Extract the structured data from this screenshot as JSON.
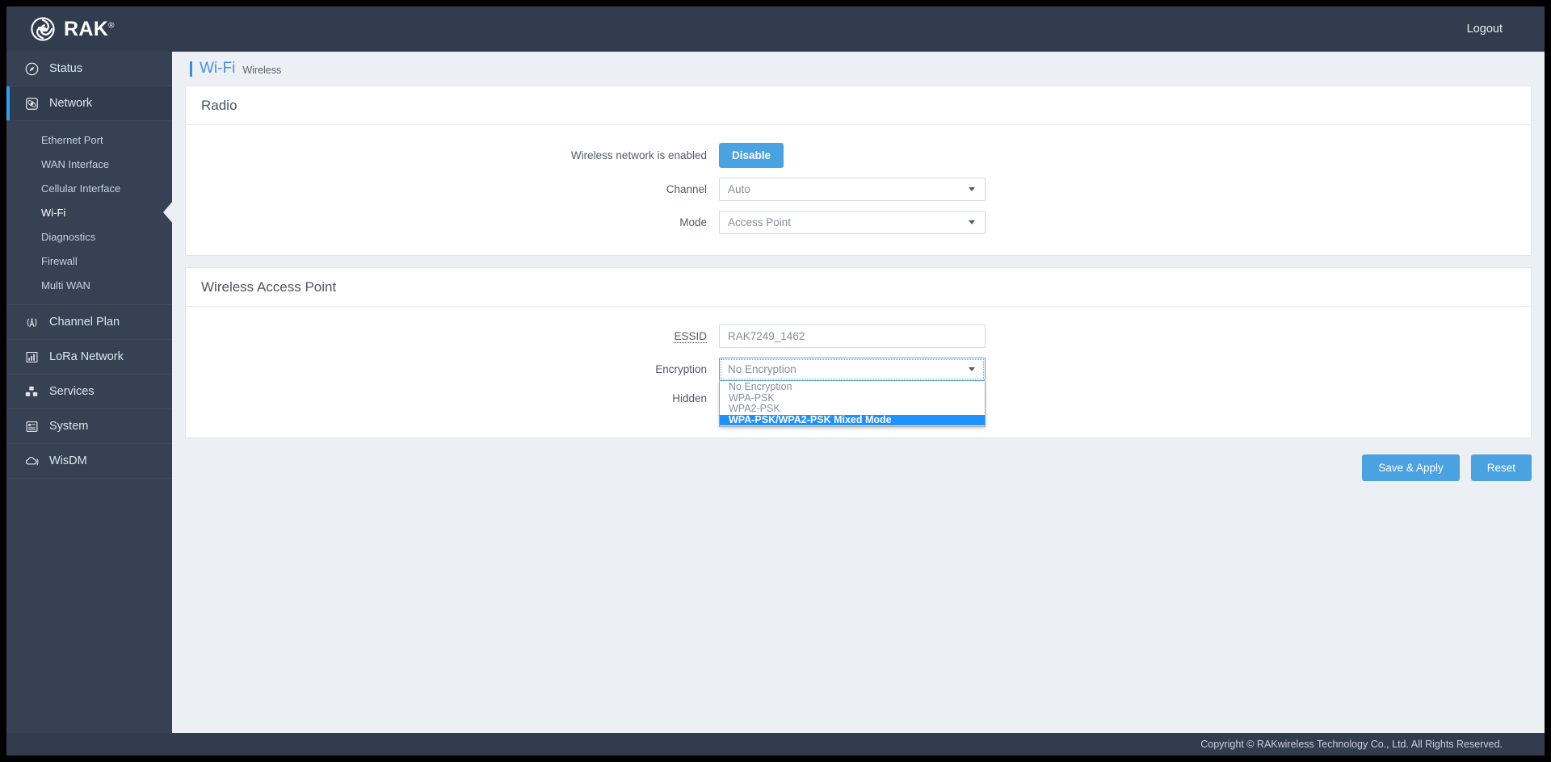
{
  "header": {
    "brand": "RAK",
    "brand_mark": "®",
    "logo_icon": "rak-swirl-logo-icon",
    "logout_label": "Logout"
  },
  "sidebar": {
    "items": [
      {
        "label": "Status",
        "icon": "compass-icon",
        "active": false
      },
      {
        "label": "Network",
        "icon": "network-atom-icon",
        "active": true
      },
      {
        "label": "Channel Plan",
        "icon": "antenna-icon",
        "active": false
      },
      {
        "label": "LoRa Network",
        "icon": "bar-chart-icon",
        "active": false
      },
      {
        "label": "Services",
        "icon": "cubes-icon",
        "active": false
      },
      {
        "label": "System",
        "icon": "list-window-icon",
        "active": false
      },
      {
        "label": "WisDM",
        "icon": "cloud-signal-icon",
        "active": false
      }
    ],
    "network_subitems": [
      {
        "label": "Ethernet Port",
        "current": false
      },
      {
        "label": "WAN Interface",
        "current": false
      },
      {
        "label": "Cellular Interface",
        "current": false
      },
      {
        "label": "Wi-Fi",
        "current": true
      },
      {
        "label": "Diagnostics",
        "current": false
      },
      {
        "label": "Firewall",
        "current": false
      },
      {
        "label": "Multi WAN",
        "current": false
      }
    ]
  },
  "page": {
    "title": "Wi-Fi",
    "subtitle": "Wireless"
  },
  "radio": {
    "heading": "Radio",
    "enabled_label": "Wireless network is enabled",
    "toggle_button": "Disable",
    "channel_label": "Channel",
    "channel_value": "Auto",
    "mode_label": "Mode",
    "mode_value": "Access Point"
  },
  "access_point": {
    "heading": "Wireless Access Point",
    "essid_label": "ESSID",
    "essid_value": "RAK7249_1462",
    "encryption_label": "Encryption",
    "encryption_value": "No Encryption",
    "encryption_options": [
      "No Encryption",
      "WPA-PSK",
      "WPA2-PSK",
      "WPA-PSK/WPA2-PSK Mixed Mode"
    ],
    "encryption_highlighted": "WPA-PSK/WPA2-PSK Mixed Mode",
    "hidden_label": "Hidden"
  },
  "actions": {
    "save_label": "Save & Apply",
    "reset_label": "Reset"
  },
  "footer": {
    "copyright": "Copyright © RAKwireless Technology Co., Ltd. All Rights Reserved."
  },
  "colors": {
    "accent_blue": "#4aa3e0",
    "sidebar": "#364254",
    "topbar": "#313d4f",
    "highlight": "#1e90ff",
    "page_bg": "#eceff4"
  }
}
